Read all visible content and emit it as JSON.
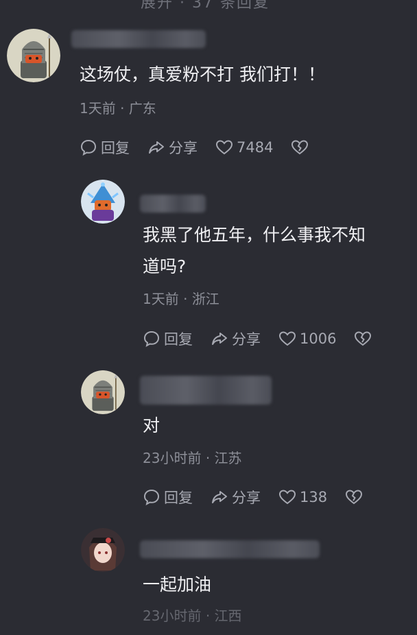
{
  "top_partial_text": "展开 · 37 条回复",
  "colors": {
    "background": "#2b2c33",
    "text": "#f0f0f3",
    "meta": "#8d8f98",
    "action": "#a7a9b2"
  },
  "comments": [
    {
      "text_lines": [
        "这场仗，真爱粉不打 我们打！！"
      ],
      "time": "1天前",
      "location": "广东",
      "reply_label": "回复",
      "share_label": "分享",
      "likes": "7484",
      "avatar_icon": "knight-avatar-icon"
    },
    {
      "text_lines": [
        "我黑了他五年，什么事我不知",
        "道吗?"
      ],
      "time": "1天前",
      "location": "浙江",
      "reply_label": "回复",
      "share_label": "分享",
      "likes": "1006",
      "avatar_icon": "mage-avatar-icon"
    },
    {
      "text_lines": [
        "对"
      ],
      "time": "23小时前",
      "location": "江苏",
      "reply_label": "回复",
      "share_label": "分享",
      "likes": "138",
      "avatar_icon": "knight-avatar-icon"
    },
    {
      "text_lines": [
        "一起加油"
      ],
      "time": "23小时前",
      "location": "江西",
      "avatar_icon": "anime-girl-avatar-icon"
    }
  ]
}
